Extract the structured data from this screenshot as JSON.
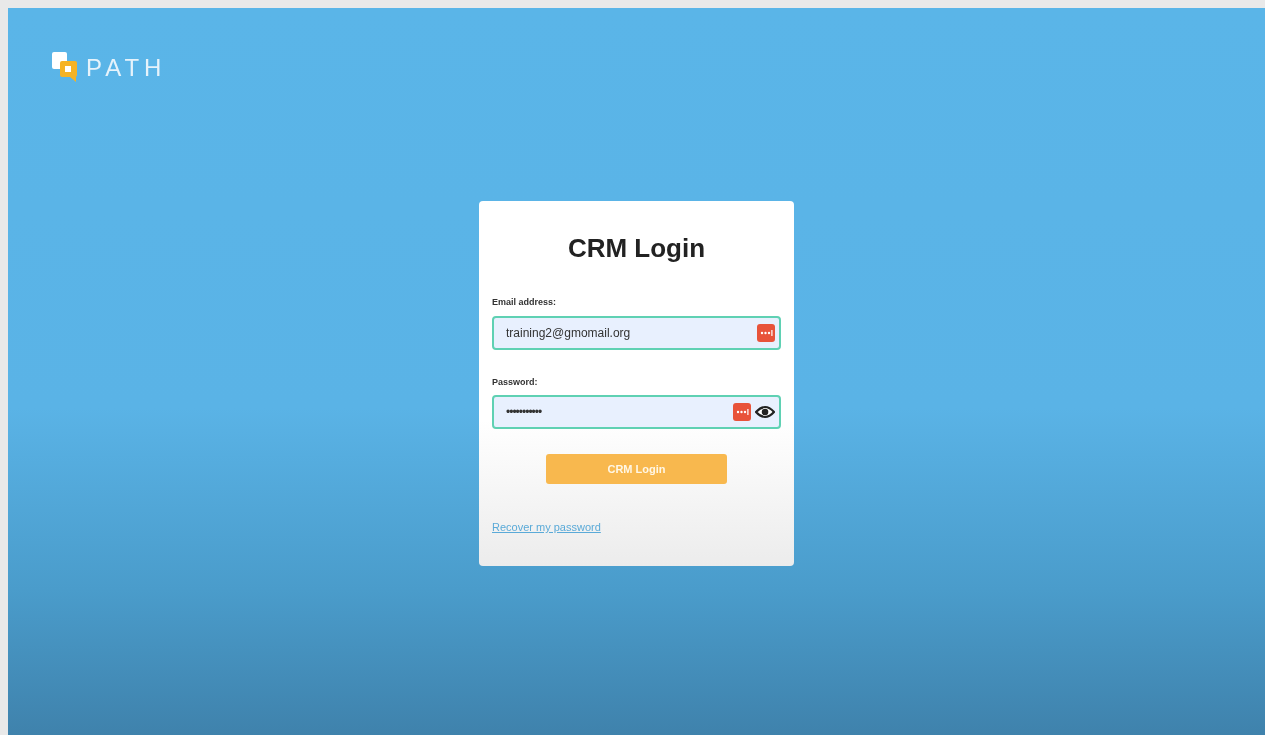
{
  "logo": {
    "text": "PATH"
  },
  "login_card": {
    "title": "CRM Login",
    "fields": [
      {
        "label": "Email address:",
        "value": "training2@gmomail.org",
        "kind": "email"
      },
      {
        "label": "Password:",
        "value": "•••••••••••",
        "kind": "password"
      }
    ],
    "submit_button": "CRM Login",
    "recover_link": "Recover my password"
  }
}
